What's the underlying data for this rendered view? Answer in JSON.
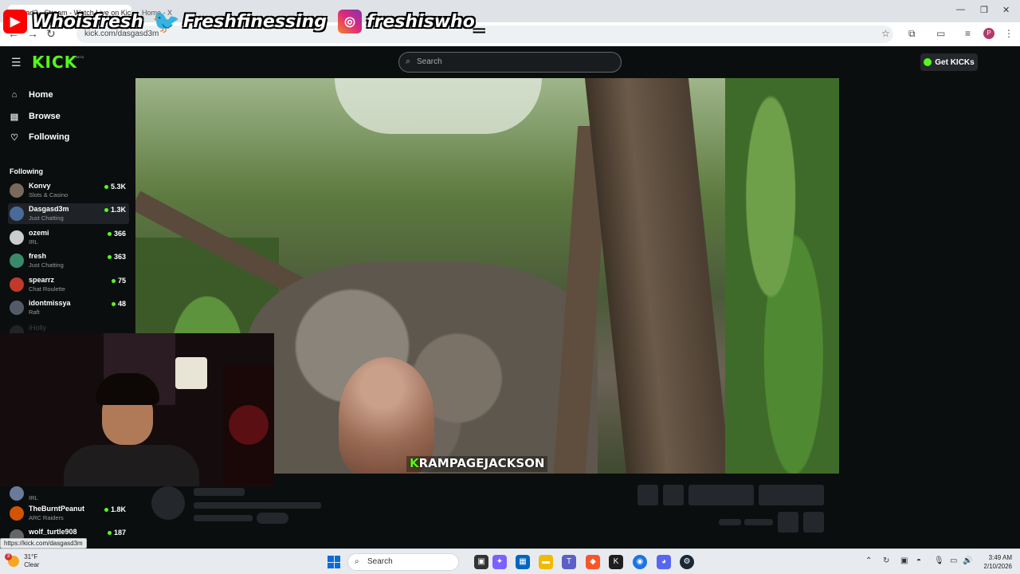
{
  "browser": {
    "tabs": [
      {
        "label": "asgad3 - Stream - Watch Live on Kick"
      },
      {
        "label": "Home - X"
      }
    ],
    "url": "kick.com/dasgasd3m"
  },
  "overlay": {
    "youtube": "Whoisfresh",
    "twitter": "Freshfinessing",
    "instagram": "freshiswho_"
  },
  "kick": {
    "logo": "KICK",
    "beta": "BETA",
    "search_placeholder": "Search",
    "get_kicks": "Get KICKs"
  },
  "sidebar": {
    "nav": [
      {
        "label": "Home",
        "icon": "home-icon"
      },
      {
        "label": "Browse",
        "icon": "browse-icon"
      },
      {
        "label": "Following",
        "icon": "heart-icon"
      }
    ],
    "section_title": "Following",
    "channels": [
      {
        "name": "Konvy",
        "category": "Slots & Casino",
        "viewers": "5.3K",
        "color": "#7a6a5c"
      },
      {
        "name": "Dasgasd3m",
        "category": "Just Chatting",
        "viewers": "1.3K",
        "color": "#4a6a9a"
      },
      {
        "name": "ozemi",
        "category": "IRL",
        "viewers": "366",
        "color": "#cccccc"
      },
      {
        "name": "fresh",
        "category": "Just Chatting",
        "viewers": "363",
        "color": "#3a8a6a"
      },
      {
        "name": "spearrz",
        "category": "Chat Roulette",
        "viewers": "75",
        "color": "#c0392b"
      },
      {
        "name": "idontmissya",
        "category": "Raft",
        "viewers": "48",
        "color": "#555b66"
      },
      {
        "name": "iHolly",
        "category": "",
        "viewers": "",
        "color": "#444"
      }
    ],
    "lower_channels": [
      {
        "name": "",
        "category": "IRL",
        "viewers": "",
        "color": "#6a7a9a"
      },
      {
        "name": "TheBurntPeanut",
        "category": "ARC Raiders",
        "viewers": "1.8K",
        "color": "#d35400"
      },
      {
        "name": "wolf_turtle908",
        "category": "",
        "viewers": "187",
        "color": "#666"
      }
    ]
  },
  "video": {
    "caption_k": "K",
    "caption_text": "RAMPAGEJACKSON"
  },
  "status_url": "https://kick.com/dasgasd3m",
  "taskbar": {
    "weather_temp": "31°F",
    "weather_desc": "Clear",
    "weather_badge": "3",
    "search": "Search",
    "time": "3:49 AM",
    "date": "2/10/2026"
  }
}
